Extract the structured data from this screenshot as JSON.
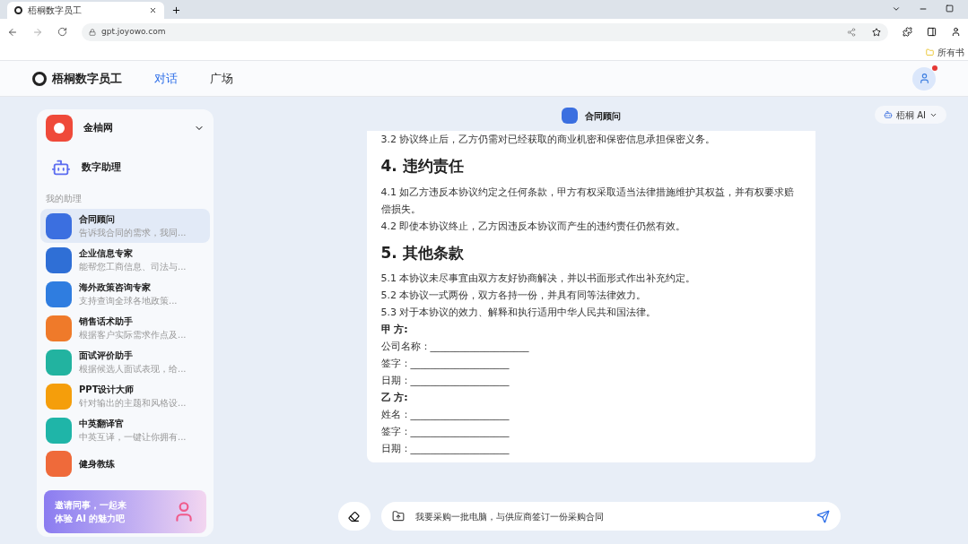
{
  "browser": {
    "tab_title": "梧桐数字员工",
    "url": "gpt.joyowo.com",
    "bookmark": "所有书"
  },
  "header": {
    "brand": "梧桐数字员工",
    "nav": [
      {
        "label": "对话",
        "selected": true
      },
      {
        "label": "广场",
        "selected": false
      }
    ],
    "notification": true
  },
  "sidebar": {
    "workspace": "金柚网",
    "assistant_home": "数字助理",
    "section": "我的助理",
    "items": [
      {
        "name": "合同顾问",
        "desc": "告诉我合同的需求，我同...",
        "color": "#3b6fe0",
        "selected": true
      },
      {
        "name": "企业信息专家",
        "desc": "能帮您工商信息、司法与...",
        "color": "#2f6fd6",
        "selected": false
      },
      {
        "name": "海外政策咨询专家",
        "desc": "支持查询全球各地政策...",
        "color": "#2f7de0",
        "selected": false
      },
      {
        "name": "销售话术助手",
        "desc": "根据客户实际需求作点及...",
        "color": "#ef7a2a",
        "selected": false
      },
      {
        "name": "面试评价助手",
        "desc": "根据候选人面试表现，给...",
        "color": "#22b3a0",
        "selected": false
      },
      {
        "name": "PPT设计大师",
        "desc": "针对输出的主题和风格设...",
        "color": "#f59e0b",
        "selected": false
      },
      {
        "name": "中英翻译官",
        "desc": "中英互译，一键让你拥有...",
        "color": "#1fb5a8",
        "selected": false
      },
      {
        "name": "健身教练",
        "color": "#ef6a3a",
        "selected": false
      }
    ],
    "banner": [
      "邀请同事，一起来",
      "体验 AI 的魅力吧"
    ]
  },
  "chat": {
    "title": "合同顾问",
    "model": "梧桐 AI",
    "blocks": [
      {
        "kind": "p",
        "text": "3.2 协议终止后，乙方仍需对已经获取的商业机密和保密信息承担保密义务。"
      },
      {
        "kind": "h",
        "text": "4. 违约责任"
      },
      {
        "kind": "p",
        "text": "4.1 如乙方违反本协议约定之任何条款，甲方有权采取适当法律措施维护其权益，并有权要求赔偿损失。"
      },
      {
        "kind": "p",
        "text": "4.2 即使本协议终止，乙方因违反本协议而产生的违约责任仍然有效。"
      },
      {
        "kind": "h",
        "text": "5. 其他条款"
      },
      {
        "kind": "p",
        "text": "5.1 本协议未尽事宜由双方友好协商解决，并以书面形式作出补充约定。"
      },
      {
        "kind": "p",
        "text": "5.2 本协议一式两份，双方各持一份，并具有同等法律效力。"
      },
      {
        "kind": "p",
        "text": "5.3 对于本协议的效力、解释和执行适用中华人民共和国法律。"
      },
      {
        "kind": "b",
        "text": "甲 方:"
      },
      {
        "kind": "p",
        "text": "公司名称：____________________"
      },
      {
        "kind": "p",
        "text": "签字：____________________"
      },
      {
        "kind": "p",
        "text": "日期：____________________"
      },
      {
        "kind": "b",
        "text": "乙 方:"
      },
      {
        "kind": "p",
        "text": "姓名：____________________"
      },
      {
        "kind": "p",
        "text": "签字：____________________"
      },
      {
        "kind": "p",
        "text": "日期：____________________"
      }
    ],
    "input": "我要采购一批电脑，与供应商签订一份采购合同"
  }
}
